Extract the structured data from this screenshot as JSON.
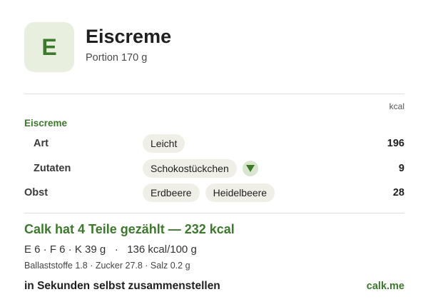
{
  "header": {
    "badge_letter": "E",
    "title": "Eiscreme",
    "portion": "Portion 170 g"
  },
  "table": {
    "unit_header": "kcal",
    "section_label": "Eiscreme",
    "rows": [
      {
        "label": "Art",
        "chips": [
          "Leicht"
        ],
        "has_dropdown": false,
        "kcal": "196"
      },
      {
        "label": "Zutaten",
        "chips": [
          "Schokostückchen"
        ],
        "has_dropdown": true,
        "kcal": "9"
      },
      {
        "label": "Obst",
        "chips": [
          "Erdbeere",
          "Heidelbeere"
        ],
        "has_dropdown": false,
        "kcal": "28"
      }
    ]
  },
  "summary": {
    "headline": "Calk hat 4 Teile gezählt — 232 kcal",
    "macros": "E 6 · F 6 · K 39 g   ·   136 kcal/100 g",
    "details": "Ballaststoffe 1.8 · Zucker 27.8 · Salz 0.2 g"
  },
  "footer": {
    "cta": "in Sekunden selbst zusammenstellen",
    "brand": "calk.me"
  },
  "colors": {
    "accent": "#3c7a2b",
    "badge_bg": "#e8efdf",
    "chip_bg": "#efefe8"
  },
  "icons": {
    "dropdown": "triangle-down-icon"
  }
}
